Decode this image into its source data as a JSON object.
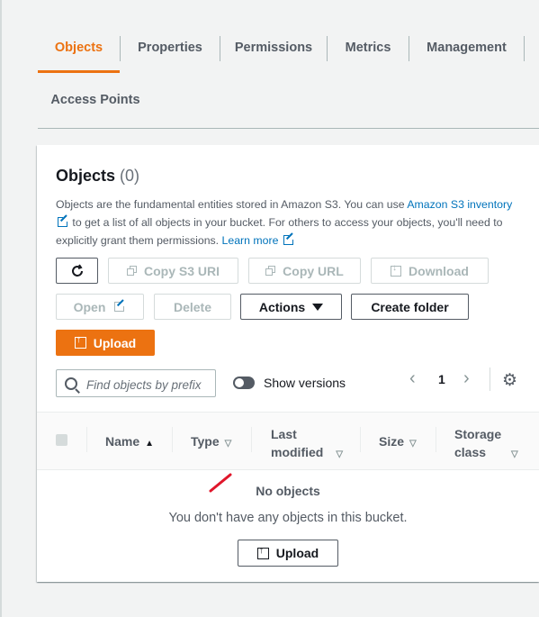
{
  "tabs": [
    {
      "label": "Objects"
    },
    {
      "label": "Properties"
    },
    {
      "label": "Permissions"
    },
    {
      "label": "Metrics"
    },
    {
      "label": "Management"
    },
    {
      "label": "Access Points"
    }
  ],
  "panel": {
    "title": "Objects",
    "count": "(0)",
    "desc_1": "Objects are the fundamental entities stored in Amazon S3. You can use ",
    "link_inventory": "Amazon S3 inventory",
    "desc_2": " to get a list of all objects in your bucket. For others to access your objects, you'll need to explicitly grant them permissions. ",
    "link_learn": "Learn more"
  },
  "toolbar": {
    "copy_uri": "Copy S3 URI",
    "copy_url": "Copy URL",
    "download": "Download",
    "open": "Open",
    "delete": "Delete",
    "actions": "Actions",
    "create_folder": "Create folder",
    "upload": "Upload"
  },
  "search": {
    "placeholder": "Find objects by prefix",
    "value": ""
  },
  "show_versions": {
    "label": "Show versions",
    "enabled": false
  },
  "pagination": {
    "page": "1"
  },
  "table": {
    "columns": [
      {
        "label": "Name",
        "sort": "▲"
      },
      {
        "label": "Type",
        "sort": "▽"
      },
      {
        "label_1": "Last",
        "label_2": "modified",
        "sort": "▽"
      },
      {
        "label": "Size",
        "sort": "▽"
      },
      {
        "label_1": "Storage",
        "label_2": "class",
        "sort": "▽"
      }
    ],
    "empty_title": "No objects",
    "empty_message": "You don't have any objects in this bucket.",
    "empty_upload": "Upload"
  },
  "colors": {
    "accent": "#ec7211",
    "link": "#0073bb",
    "annotation": "#e0162b"
  }
}
